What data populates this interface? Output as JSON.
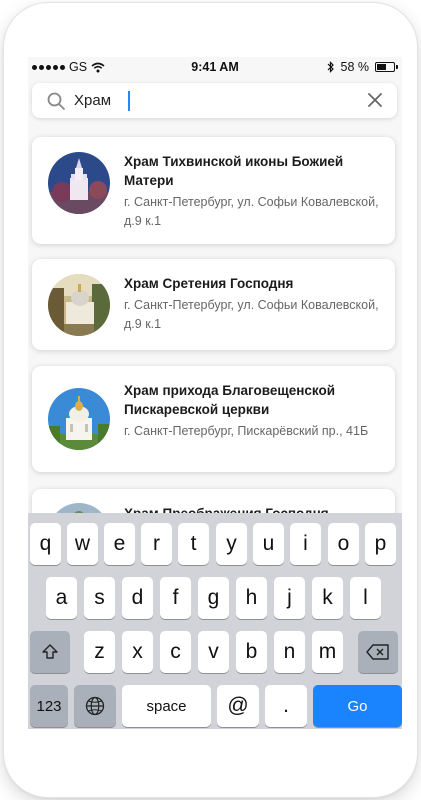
{
  "status": {
    "carrier": "GS",
    "time": "9:41 AM",
    "battery": "58 %",
    "battery_level": 0.58
  },
  "search": {
    "value": "Храм",
    "placeholder": ""
  },
  "results": [
    {
      "title": "Храм Тихвинской иконы Божией Матери",
      "address": "г. Санкт-Петербург, ул. Софьи Ковалевской, д.9 к.1"
    },
    {
      "title": "Храм Сретения Господня",
      "address": "г. Санкт-Петербург, ул. Софьи Ковалевской, д.9 к.1"
    },
    {
      "title": "Храм прихода Благовещенской Пискаревской церкви",
      "address": "г. Санкт-Петербург, Пискарёвский пр., 41Б"
    },
    {
      "title": "Храм Преображения Господня",
      "address": ""
    }
  ],
  "keyboard": {
    "row1": [
      "q",
      "w",
      "e",
      "r",
      "t",
      "y",
      "u",
      "i",
      "o",
      "p"
    ],
    "row2": [
      "a",
      "s",
      "d",
      "f",
      "g",
      "h",
      "j",
      "k",
      "l"
    ],
    "row3": [
      "z",
      "x",
      "c",
      "v",
      "b",
      "n",
      "m"
    ],
    "numbers": "123",
    "space": "space",
    "at": "@",
    "dot": ".",
    "go": "Go"
  },
  "colors": {
    "accent": "#1a84ff",
    "card_title": "#1b1b1b",
    "card_address": "#666666"
  }
}
